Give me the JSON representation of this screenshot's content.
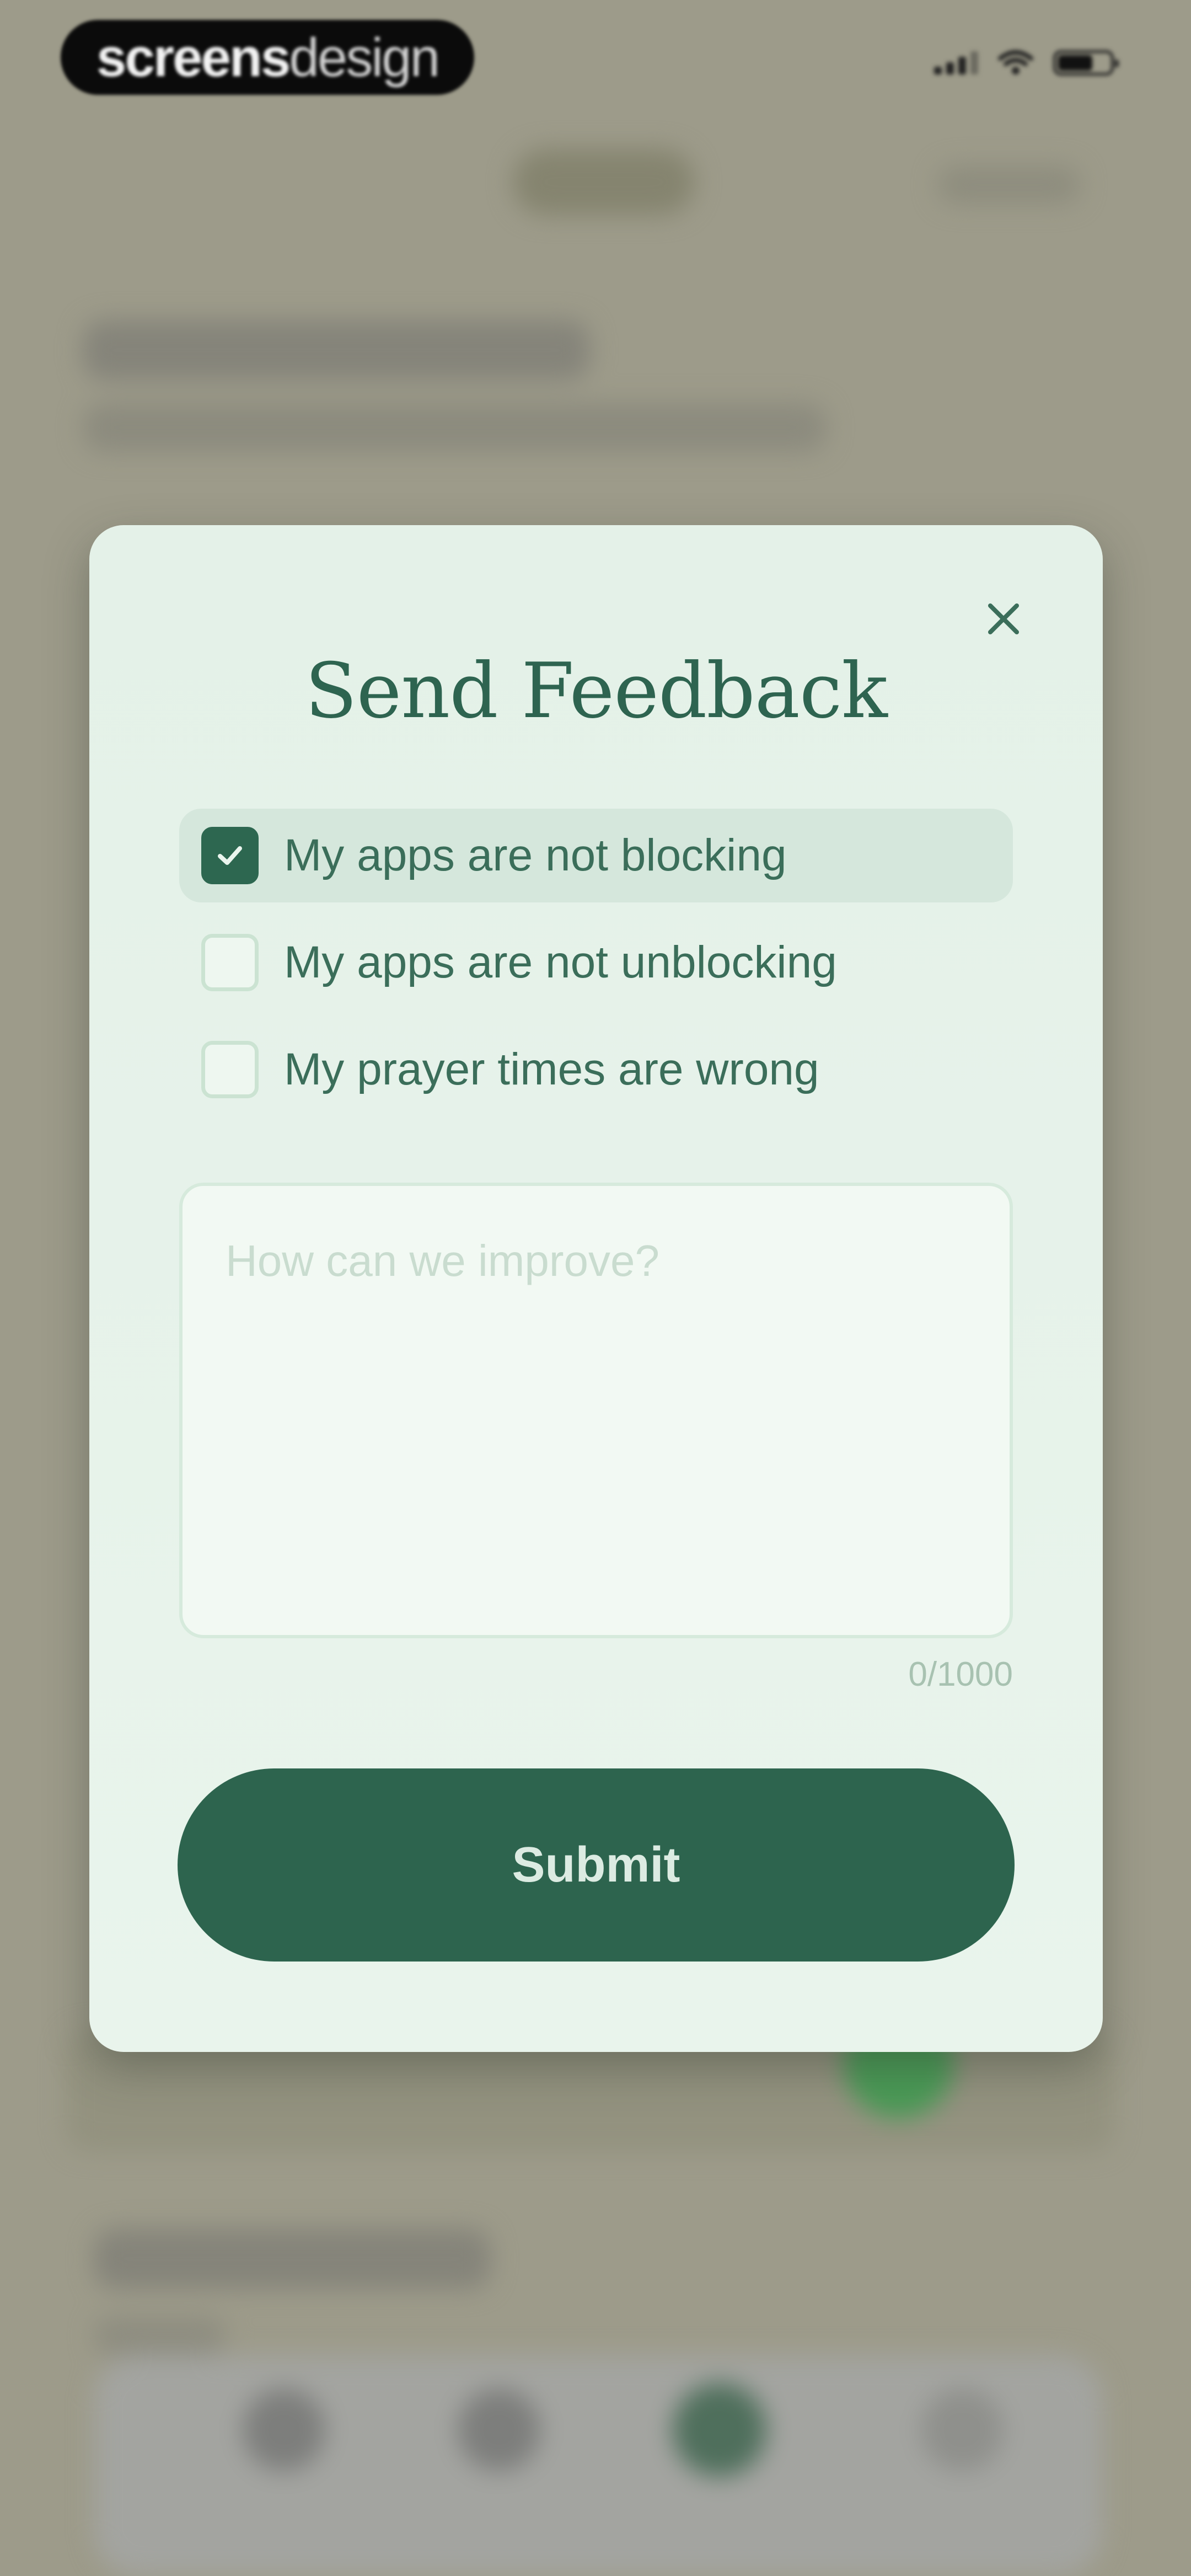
{
  "watermark": {
    "bold": "screens",
    "light": "design"
  },
  "modal": {
    "title": "Send Feedback",
    "options": [
      {
        "label": "My apps are not blocking",
        "checked": true
      },
      {
        "label": "My apps are not unblocking",
        "checked": false
      },
      {
        "label": "My prayer times are wrong",
        "checked": false
      }
    ],
    "feedback": {
      "placeholder": "How can we improve?",
      "value": ""
    },
    "char_count": "0/1000",
    "submit_label": "Submit"
  },
  "colors": {
    "accent": "#2d644e",
    "title": "#2e6450",
    "modal_bg": "#e6f2ea",
    "backdrop": "#9d9b8a"
  },
  "icons": {
    "close": "close-icon",
    "check": "check-icon"
  }
}
